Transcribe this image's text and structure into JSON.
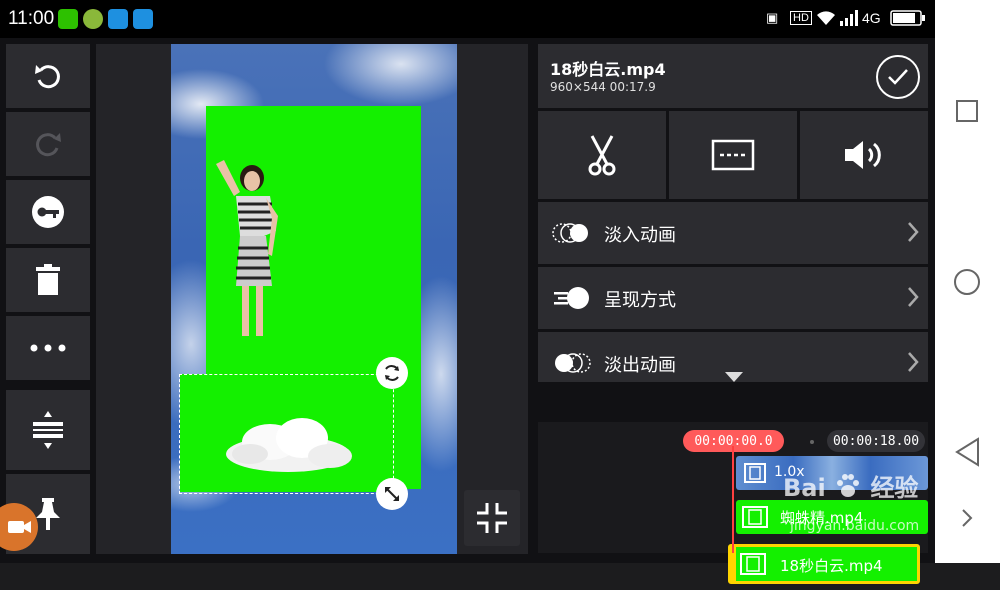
{
  "status_bar": {
    "time": "11:00",
    "network": "4G",
    "hd": "HD",
    "app_icons": [
      {
        "name": "wechat-icon",
        "color": "#2dc100"
      },
      {
        "name": "game-icon",
        "color": "#8ab83a"
      },
      {
        "name": "message-icon",
        "color": "#1e90e0"
      },
      {
        "name": "screenshot-icon",
        "color": "#1e90e0"
      }
    ]
  },
  "left_toolbar": {
    "buttons": [
      {
        "name": "undo-button",
        "icon": "undo-icon",
        "enabled": true
      },
      {
        "name": "redo-button",
        "icon": "redo-icon",
        "enabled": false
      },
      {
        "name": "keyframe-button",
        "icon": "key-icon",
        "enabled": true
      },
      {
        "name": "delete-button",
        "icon": "trash-icon",
        "enabled": true
      },
      {
        "name": "more-button",
        "icon": "more-dots-icon",
        "enabled": true
      },
      {
        "name": "split-adjust-button",
        "icon": "adjust-lines-icon",
        "enabled": true
      },
      {
        "name": "pin-button",
        "icon": "pin-icon",
        "enabled": true
      }
    ]
  },
  "clip_panel": {
    "title": "18秒白云.mp4",
    "meta": "960×544 00:17.9",
    "tools": [
      "scissors-icon",
      "caption-icon",
      "volume-icon"
    ],
    "options": [
      {
        "label": "淡入动画",
        "icon": "fade-in-icon"
      },
      {
        "label": "呈现方式",
        "icon": "display-mode-icon"
      },
      {
        "label": "淡出动画",
        "icon": "fade-out-icon"
      }
    ]
  },
  "timeline": {
    "current_time": "00:00:00.0",
    "end_time": "00:00:18.00",
    "tracks": [
      {
        "label": "1.0x",
        "type": "main-video"
      },
      {
        "label": "蜘蛛精.mp4",
        "type": "overlay"
      },
      {
        "label": "18秒白云.mp4",
        "type": "overlay-selected"
      }
    ]
  },
  "watermark": {
    "brand": "Bai",
    "brand_suffix": "经验",
    "url": "jingyan.baidu.com"
  },
  "colors": {
    "chroma_green": "#14f000",
    "playhead_red": "#ff5a5a",
    "selection_yellow": "#ffd400",
    "panel_bg": "#2c2c30"
  }
}
